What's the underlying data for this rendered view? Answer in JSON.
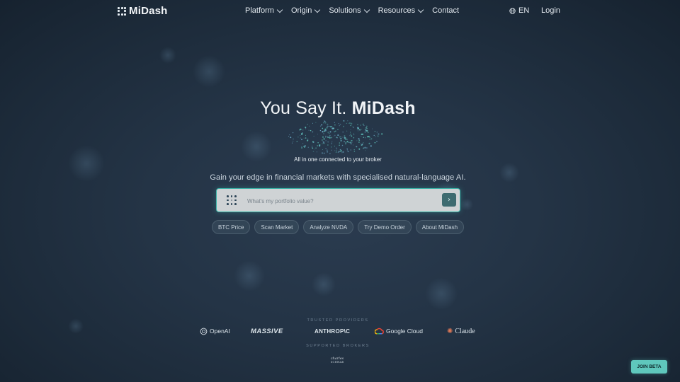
{
  "brand": {
    "name": "MiDash"
  },
  "nav": {
    "items": [
      {
        "label": "Platform",
        "has_dropdown": true
      },
      {
        "label": "Origin",
        "has_dropdown": true
      },
      {
        "label": "Solutions",
        "has_dropdown": true
      },
      {
        "label": "Resources",
        "has_dropdown": true
      },
      {
        "label": "Contact",
        "has_dropdown": false
      }
    ],
    "language": "EN",
    "login": "Login"
  },
  "hero": {
    "title_regular": "You Say It.",
    "title_bold": "MiDash",
    "subtitle": "All in one connected to your broker",
    "tagline": "Gain your edge in financial markets with specialised natural-language AI."
  },
  "search": {
    "placeholder": "What's my portfolio value?",
    "submit_icon": "chevron-right-icon"
  },
  "suggestions": [
    "BTC Price",
    "Scan Market",
    "Analyze NVDA",
    "Try Demo Order",
    "About MiDash"
  ],
  "providers": {
    "heading": "TRUSTED PROVIDERS",
    "items": [
      "OpenAI",
      "MASSIVE",
      "ANTHROP\\C",
      "Google Cloud",
      "Claude"
    ]
  },
  "brokers": {
    "heading": "SUPPORTED BROKERS",
    "items": [
      {
        "script": "charles",
        "name": "SCHWAB"
      }
    ]
  },
  "cta": {
    "join_beta": "JOIN BETA"
  },
  "colors": {
    "accent": "#5fc7bc",
    "background": "#243446",
    "search_border": "#3bb3a8"
  }
}
